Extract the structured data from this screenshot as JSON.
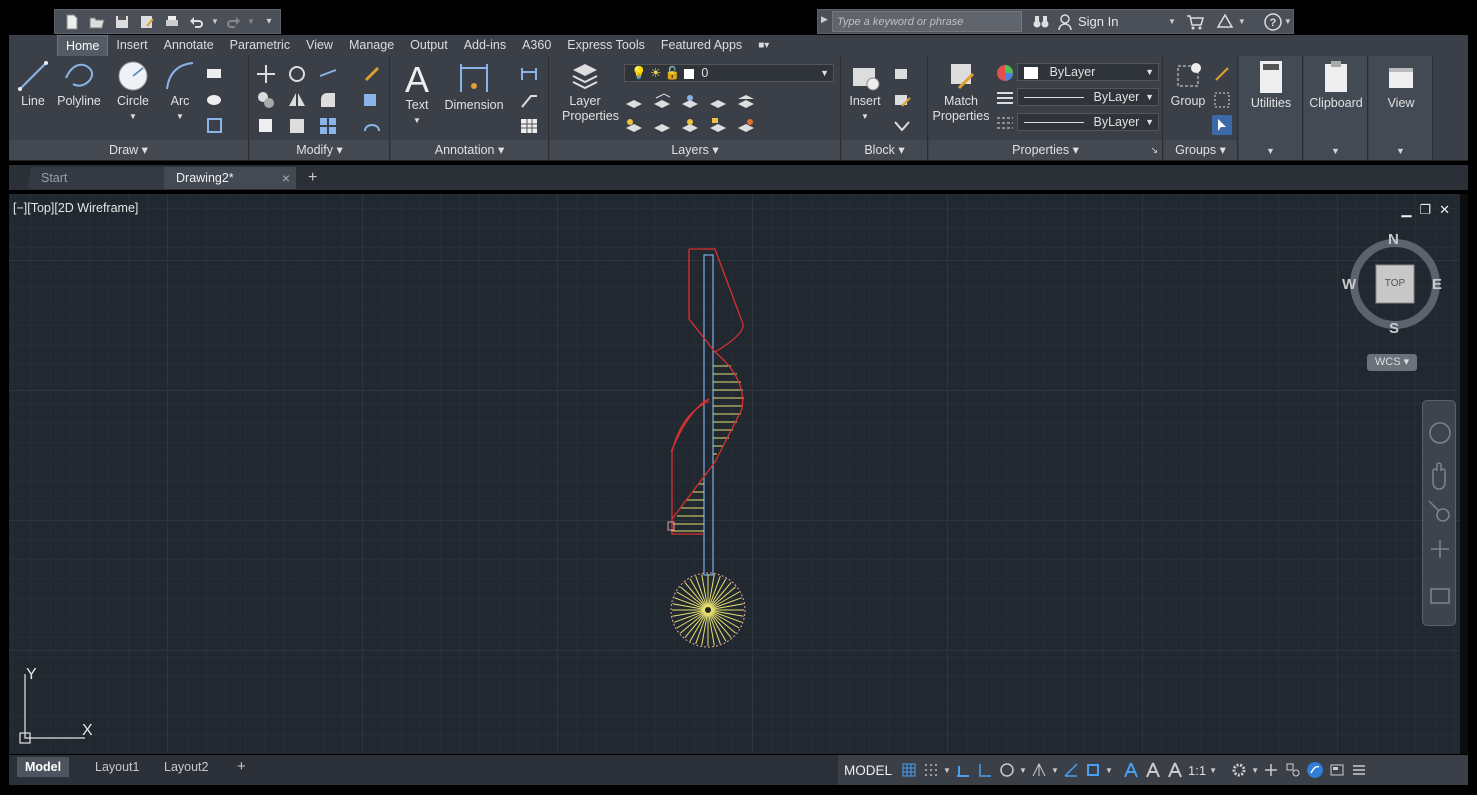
{
  "search": {
    "placeholder": "Type a keyword or phrase"
  },
  "account": {
    "sign_in": "Sign In"
  },
  "ribbon_tabs": [
    "Home",
    "Insert",
    "Annotate",
    "Parametric",
    "View",
    "Manage",
    "Output",
    "Add-ins",
    "A360",
    "Express Tools",
    "Featured Apps"
  ],
  "panels": {
    "draw": {
      "title": "Draw",
      "line": "Line",
      "polyline": "Polyline",
      "circle": "Circle",
      "arc": "Arc"
    },
    "modify": {
      "title": "Modify"
    },
    "annotation": {
      "title": "Annotation",
      "text": "Text",
      "dimension": "Dimension"
    },
    "layers": {
      "title": "Layers",
      "layer_properties_1": "Layer",
      "layer_properties_2": "Properties",
      "current_layer": "0"
    },
    "block": {
      "title": "Block",
      "insert": "Insert"
    },
    "properties": {
      "title": "Properties",
      "match_1": "Match",
      "match_2": "Properties",
      "color": "ByLayer",
      "linetype": "ByLayer",
      "lineweight": "ByLayer"
    },
    "groups": {
      "title": "Groups",
      "group": "Group"
    },
    "utilities": {
      "label": "Utilities"
    },
    "clipboard": {
      "label": "Clipboard"
    },
    "view": {
      "label": "View"
    }
  },
  "doc_tabs": {
    "start": "Start",
    "drawing": "Drawing2*",
    "close": "×",
    "new": "+"
  },
  "viewport": {
    "label": "[−][Top][2D Wireframe]"
  },
  "viewcube": {
    "n": "N",
    "s": "S",
    "e": "E",
    "w": "W",
    "face": "TOP",
    "wcs": "WCS"
  },
  "ucs": {
    "x": "X",
    "y": "Y"
  },
  "layout_tabs": [
    "Model",
    "Layout1",
    "Layout2"
  ],
  "status": {
    "model": "MODEL",
    "scale": "1:1"
  }
}
